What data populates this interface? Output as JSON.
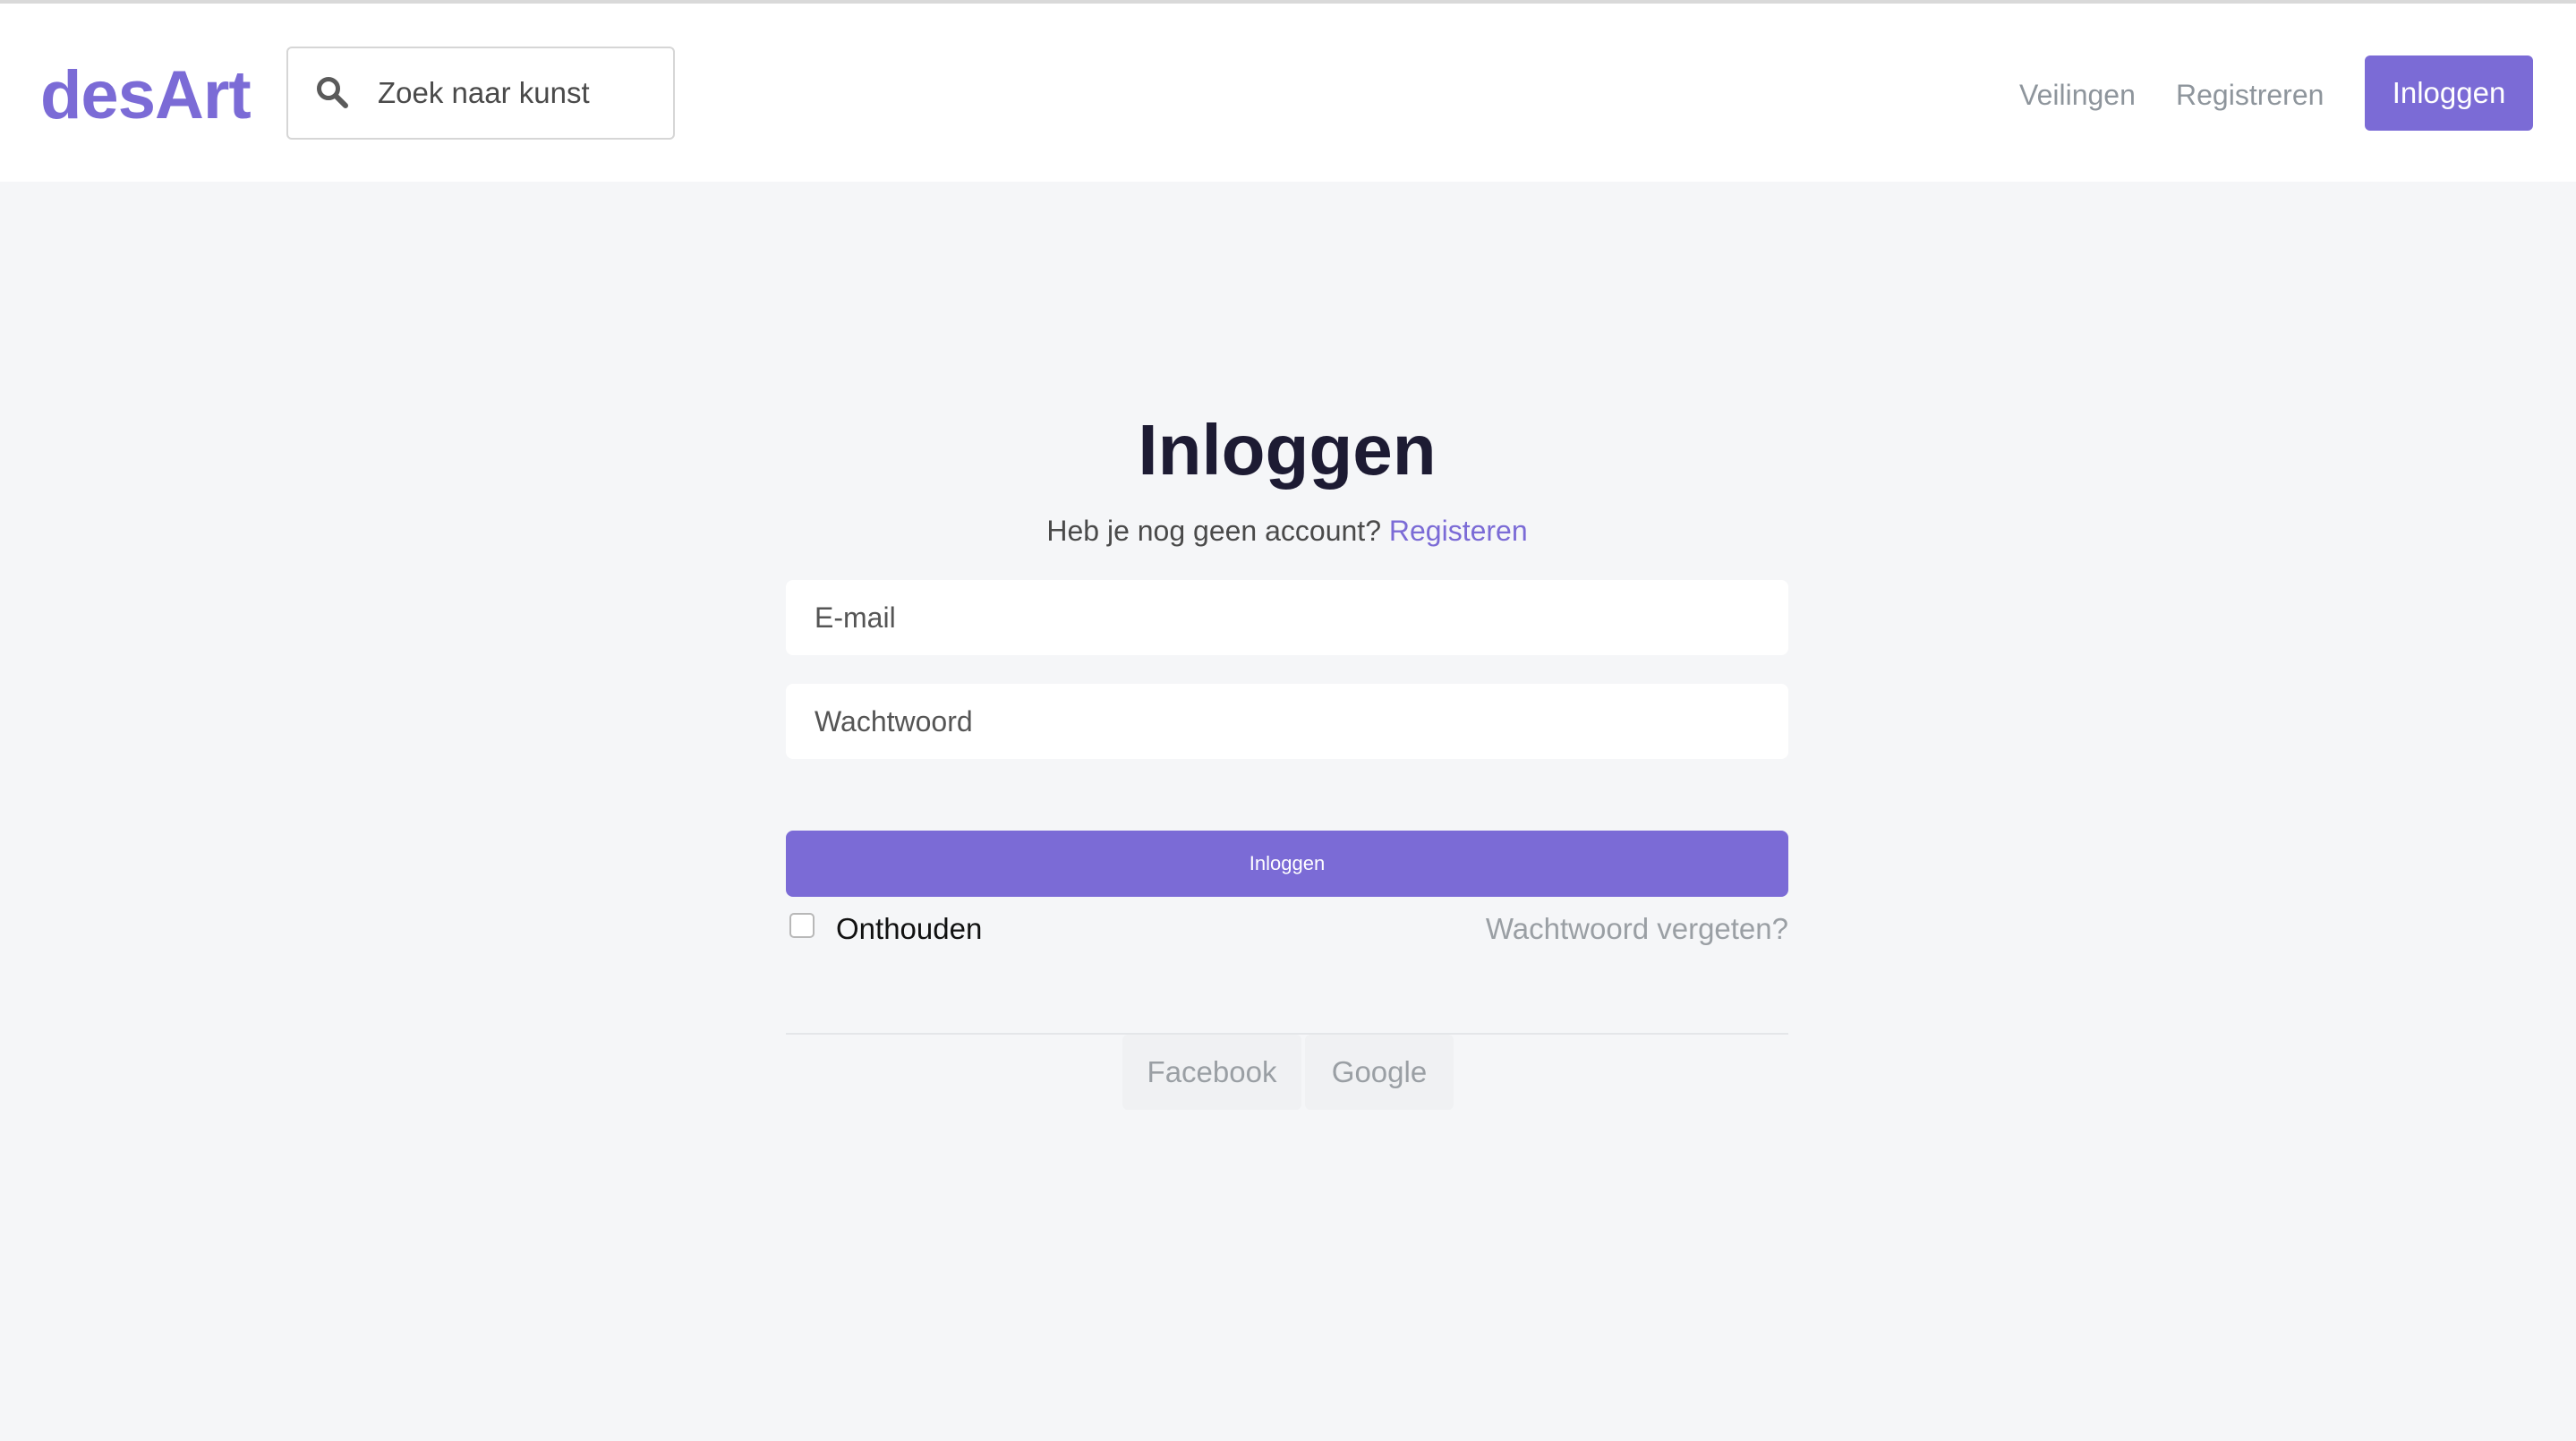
{
  "header": {
    "logo": "desArt",
    "search": {
      "placeholder": "Zoek naar kunst"
    },
    "nav": {
      "auctions": "Veilingen",
      "register": "Registreren",
      "login": "Inloggen"
    }
  },
  "login_form": {
    "title": "Inloggen",
    "subtitle_prefix": "Heb je nog geen account?",
    "subtitle_link": "Registeren",
    "email_placeholder": "E-mail",
    "password_placeholder": "Wachtwoord",
    "submit_label": "Inloggen",
    "remember_label": "Onthouden",
    "remember_checked": false,
    "forgot_link": "Wachtwoord vergeten?",
    "social": [
      "Facebook",
      "Google"
    ]
  },
  "colors": {
    "accent": "#7b6bd6",
    "background": "#f5f6f8",
    "heading": "#1d1b33",
    "muted_text": "#8e959c"
  }
}
